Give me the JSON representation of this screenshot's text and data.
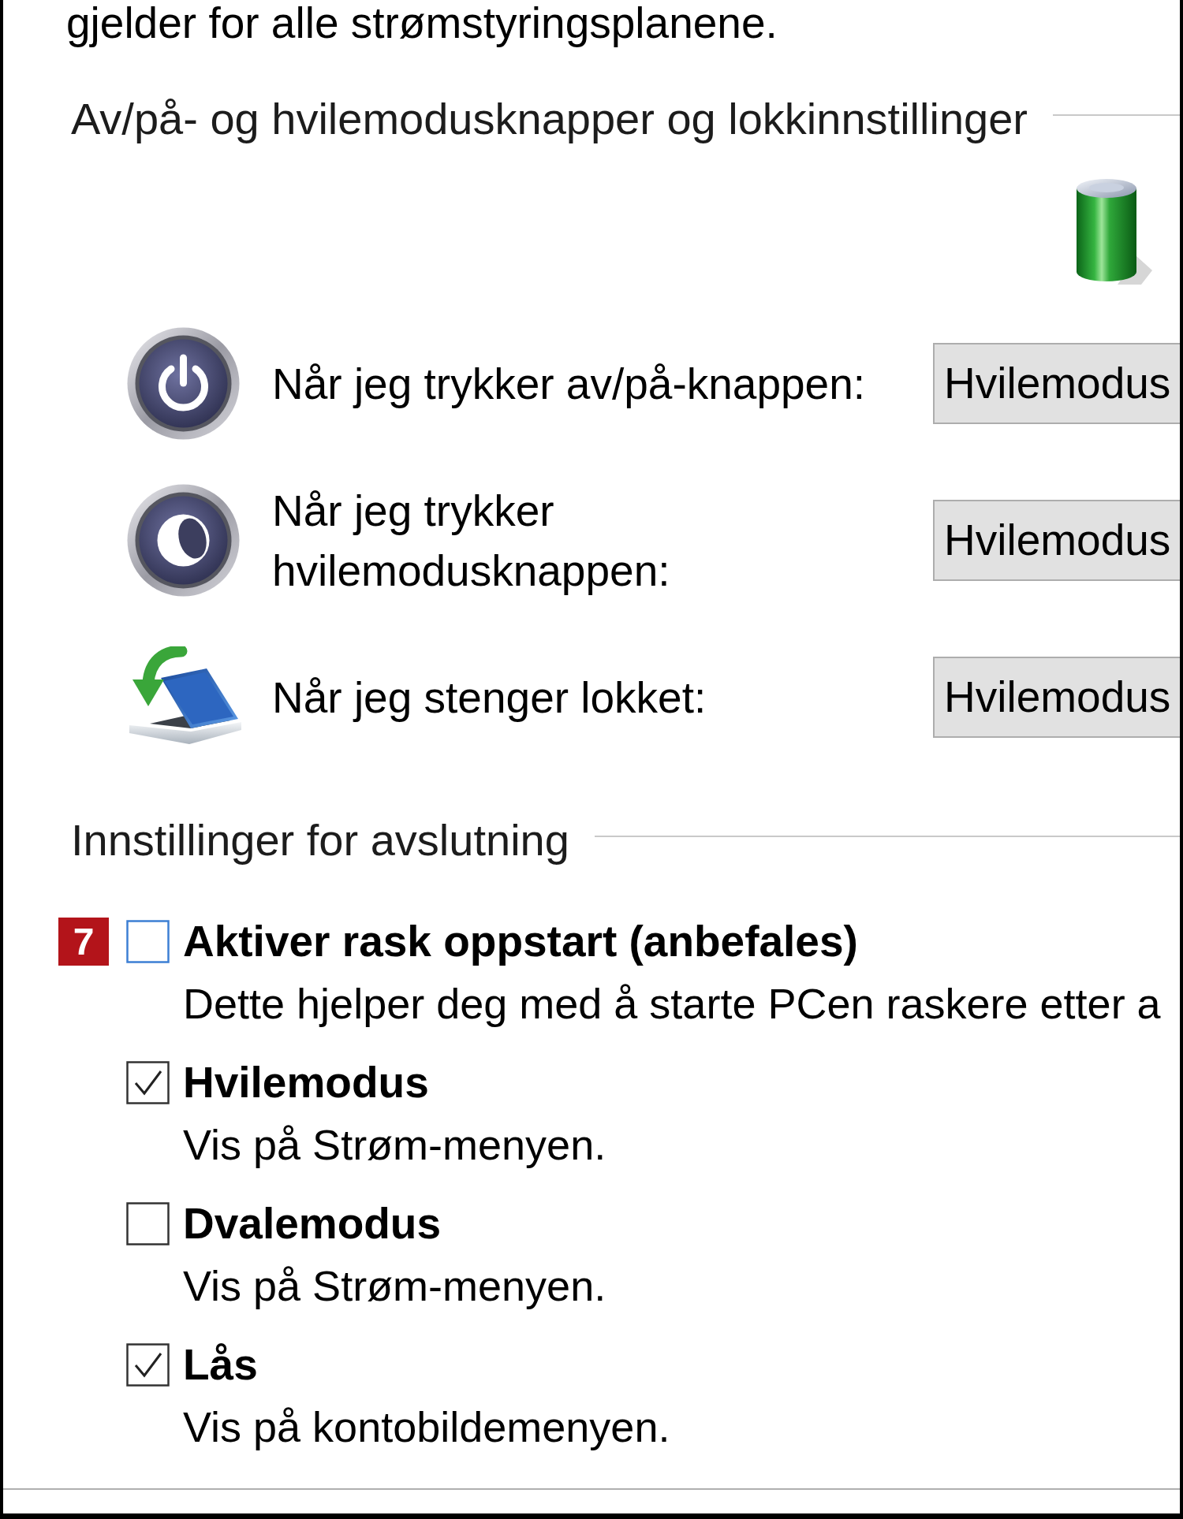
{
  "intro_text": "gjelder for alle strømstyringsplanene.",
  "button_settings": {
    "heading": "Av/på- og hvilemodusknapper og lokkinnstillinger",
    "rows": [
      {
        "kind": "power",
        "label": "Når jeg trykker av/på-knappen:",
        "value": "Hvilemodus"
      },
      {
        "kind": "sleep",
        "label": "Når jeg trykker hvilemodusknappen:",
        "value": "Hvilemodus"
      },
      {
        "kind": "lid",
        "label": "Når jeg stenger lokket:",
        "value": "Hvilemodus"
      }
    ]
  },
  "shutdown_settings": {
    "heading": "Innstillinger for avslutning",
    "options": [
      {
        "badge": "7",
        "label": "Aktiver rask oppstart (anbefales)",
        "description": "Dette hjelper deg med å starte PCen raskere etter a",
        "checked": false,
        "focused": true
      },
      {
        "label": "Hvilemodus",
        "description": "Vis på Strøm-menyen.",
        "checked": true,
        "focused": false
      },
      {
        "label": "Dvalemodus",
        "description": "Vis på Strøm-menyen.",
        "checked": false,
        "focused": false
      },
      {
        "label": "Lås",
        "description": "Vis på kontobildemenyen.",
        "checked": true,
        "focused": false
      }
    ]
  }
}
